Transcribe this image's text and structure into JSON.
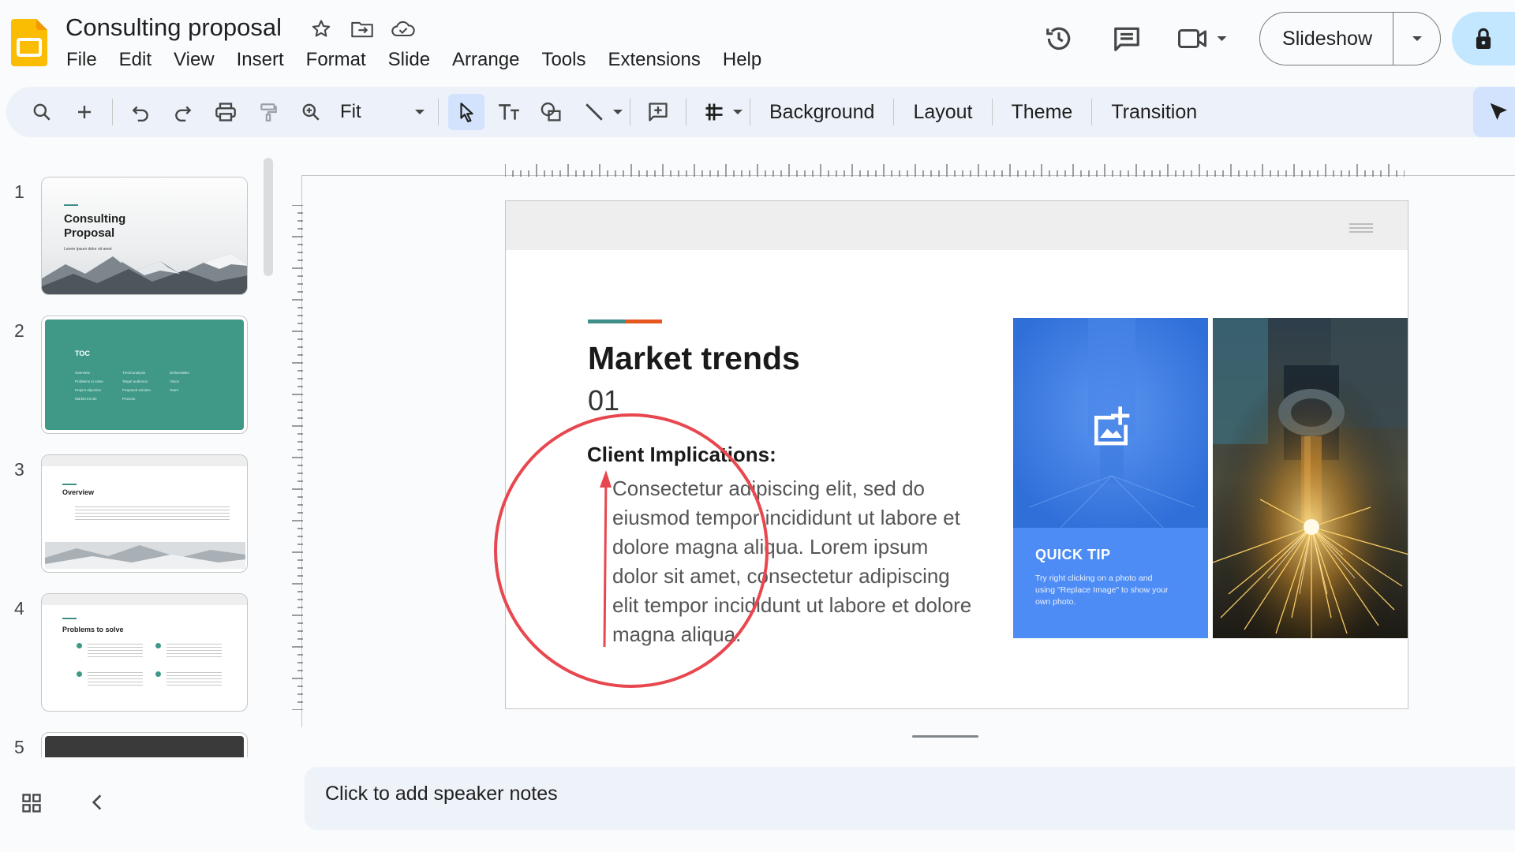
{
  "app": {
    "title": "Consulting proposal",
    "brand_color": "#fbbc04"
  },
  "menu": [
    "File",
    "Edit",
    "View",
    "Insert",
    "Format",
    "Slide",
    "Arrange",
    "Tools",
    "Extensions",
    "Help"
  ],
  "header": {
    "slideshow_label": "Slideshow",
    "icons": [
      "star-icon",
      "move-to-folder-icon",
      "cloud-saved-icon",
      "version-history-icon",
      "comments-icon",
      "meet-icon",
      "lock-icon"
    ]
  },
  "toolbar": {
    "zoom_value": "Fit",
    "background_label": "Background",
    "layout_label": "Layout",
    "theme_label": "Theme",
    "transition_label": "Transition"
  },
  "filmstrip": {
    "slides": [
      {
        "number": "1",
        "title": "Consulting Proposal",
        "subtitle": "Lorem Ipsum dolor sit amet"
      },
      {
        "number": "2",
        "title": "TOC",
        "items": [
          "Overview",
          "Problems to solve",
          "Project objective",
          "Market trends",
          "Trend analysis",
          "Target audience",
          "Proposed solution",
          "Process",
          "Deliverables",
          "Vision",
          "Team"
        ]
      },
      {
        "number": "3",
        "title": "Overview"
      },
      {
        "number": "4",
        "title": "Problems to solve"
      },
      {
        "number": "5"
      }
    ]
  },
  "slide": {
    "title": "Market trends",
    "number": "01",
    "subhead": "Client Implications:",
    "body": "Consectetur adipiscing elit, sed do eiusmod tempor incididunt ut labore et dolore magna aliqua. Lorem ipsum dolor sit amet, consectetur adipiscing elit tempor incididunt ut labore et dolore magna aliqua.",
    "tip_title": "QUICK TIP",
    "tip_text": "Try right clicking on a photo and using \"Replace Image\" to show your own photo.",
    "accent_colors": [
      "#3d8f88",
      "#e4571f"
    ],
    "annotation_color": "#e8474f"
  },
  "notes": {
    "placeholder": "Click to add speaker notes"
  }
}
